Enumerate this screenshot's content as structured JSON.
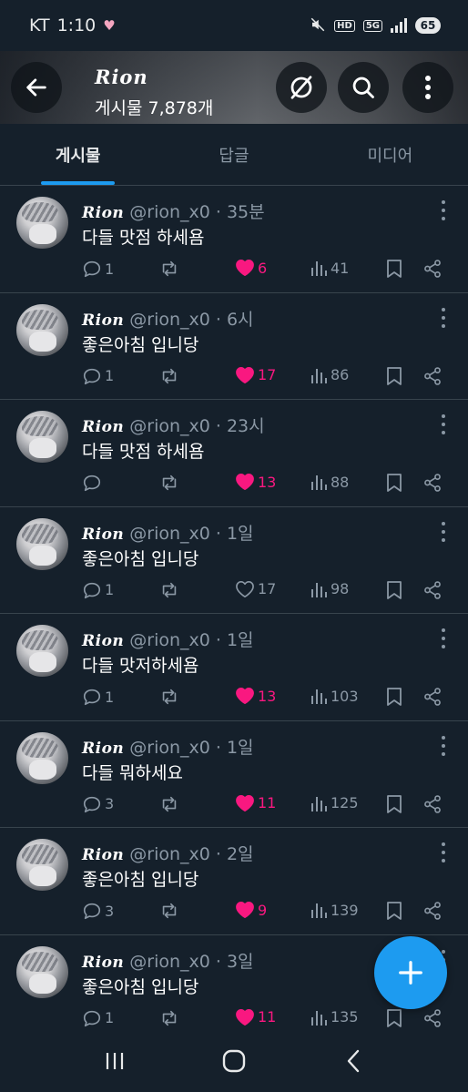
{
  "status_bar": {
    "carrier": "KT",
    "time": "1:10",
    "heart_icon": "heart-icon",
    "network_type": "5G",
    "hd_label": "HD",
    "battery": "65"
  },
  "header": {
    "title": "Rion",
    "post_count": "게시물 7,878개"
  },
  "tabs": [
    {
      "label": "게시물",
      "active": true
    },
    {
      "label": "답글",
      "active": false
    },
    {
      "label": "미디어",
      "active": false
    }
  ],
  "posts": [
    {
      "name": "Rion",
      "handle": "@rion_x0",
      "time": "· 35분",
      "text": "다들 맛점 하세욤",
      "replies": "1",
      "likes": "6",
      "liked": true,
      "views": "41"
    },
    {
      "name": "Rion",
      "handle": "@rion_x0",
      "time": "· 6시",
      "text": "좋은아침 입니당",
      "replies": "1",
      "likes": "17",
      "liked": true,
      "views": "86"
    },
    {
      "name": "Rion",
      "handle": "@rion_x0",
      "time": "· 23시",
      "text": "다들 맛점 하세욤",
      "replies": "",
      "likes": "13",
      "liked": true,
      "views": "88"
    },
    {
      "name": "Rion",
      "handle": "@rion_x0",
      "time": "· 1일",
      "text": "좋은아침 입니당",
      "replies": "1",
      "likes": "17",
      "liked": false,
      "views": "98"
    },
    {
      "name": "Rion",
      "handle": "@rion_x0",
      "time": "· 1일",
      "text": "다들 맛저하세욤",
      "replies": "1",
      "likes": "13",
      "liked": true,
      "views": "103"
    },
    {
      "name": "Rion",
      "handle": "@rion_x0",
      "time": "· 1일",
      "text": "다들 뭐하세요",
      "replies": "3",
      "likes": "11",
      "liked": true,
      "views": "125"
    },
    {
      "name": "Rion",
      "handle": "@rion_x0",
      "time": "· 2일",
      "text": "좋은아침 입니당",
      "replies": "3",
      "likes": "9",
      "liked": true,
      "views": "139"
    },
    {
      "name": "Rion",
      "handle": "@rion_x0",
      "time": "· 3일",
      "text": "좋은아침 입니당",
      "replies": "1",
      "likes": "11",
      "liked": true,
      "views": "135"
    }
  ],
  "colors": {
    "background": "#15202b",
    "accent": "#1d9bf0",
    "like": "#f91880",
    "muted": "#8b98a5"
  }
}
